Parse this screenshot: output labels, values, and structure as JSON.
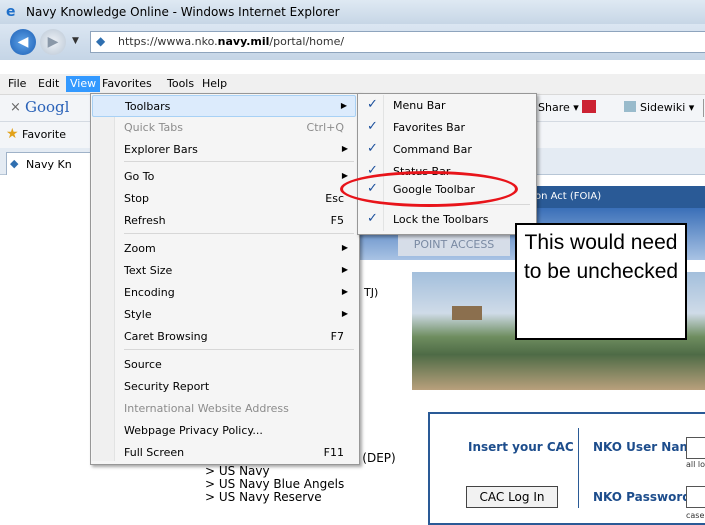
{
  "window": {
    "title": "Navy Knowledge Online - Windows Internet Explorer"
  },
  "address": {
    "url_prefix": "https://wwwa.nko.",
    "url_bold": "navy.mil",
    "url_suffix": "/portal/home/"
  },
  "menubar": [
    "File",
    "Edit",
    "View",
    "Favorites",
    "Tools",
    "Help"
  ],
  "google_toolbar": {
    "logo": "Googl",
    "share": "Share ▾",
    "sidewiki": "Sidewiki ▾"
  },
  "favorites": {
    "label": "Favorite"
  },
  "tab": {
    "label": "Navy Kn"
  },
  "view_menu": {
    "items": [
      {
        "label": "Toolbars",
        "key": "",
        "arrow": true,
        "disabled": false
      },
      {
        "label": "Quick Tabs",
        "key": "Ctrl+Q",
        "arrow": false,
        "disabled": true
      },
      {
        "label": "Explorer Bars",
        "key": "",
        "arrow": true,
        "disabled": false
      },
      {
        "label": "Go To",
        "key": "",
        "arrow": true,
        "disabled": false
      },
      {
        "label": "Stop",
        "key": "Esc",
        "arrow": false,
        "disabled": false
      },
      {
        "label": "Refresh",
        "key": "F5",
        "arrow": false,
        "disabled": false
      },
      {
        "label": "Zoom",
        "key": "",
        "arrow": true,
        "disabled": false
      },
      {
        "label": "Text Size",
        "key": "",
        "arrow": true,
        "disabled": false
      },
      {
        "label": "Encoding",
        "key": "",
        "arrow": true,
        "disabled": false
      },
      {
        "label": "Style",
        "key": "",
        "arrow": true,
        "disabled": false
      },
      {
        "label": "Caret Browsing",
        "key": "F7",
        "arrow": false,
        "disabled": false
      },
      {
        "label": "Source",
        "key": "",
        "arrow": false,
        "disabled": false
      },
      {
        "label": "Security Report",
        "key": "",
        "arrow": false,
        "disabled": false
      },
      {
        "label": "International Website Address",
        "key": "",
        "arrow": false,
        "disabled": true
      },
      {
        "label": "Webpage Privacy Policy...",
        "key": "",
        "arrow": false,
        "disabled": false
      },
      {
        "label": "Full Screen",
        "key": "F11",
        "arrow": false,
        "disabled": false
      }
    ]
  },
  "toolbars_submenu": {
    "items": [
      {
        "label": "Menu Bar",
        "checked": true
      },
      {
        "label": "Favorites Bar",
        "checked": true
      },
      {
        "label": "Command Bar",
        "checked": true
      },
      {
        "label": "Status Bar",
        "checked": true
      },
      {
        "label": "Google Toolbar",
        "checked": true
      },
      {
        "label": "Lock the Toolbars",
        "checked": true
      }
    ]
  },
  "page": {
    "foia": "on Act (FOIA)",
    "nko_title": "NAVY Kn",
    "point_access": "POINT ACCESS",
    "tj": "TJ)",
    "insert_cac": "Insert your CAC",
    "cac_login": "CAC Log In",
    "nko_user": "NKO User Name:",
    "nko_pass": "NKO Password:",
    "all_lo": "all lo",
    "case": "case",
    "links": [
      "> Delayed Entry Program (DEP)",
      "> US Navy",
      "> US Navy Blue Angels",
      "> US Navy Reserve"
    ]
  },
  "annotation": {
    "callout": "This would need to be unchecked",
    "highlight_color": "#e8141a"
  }
}
